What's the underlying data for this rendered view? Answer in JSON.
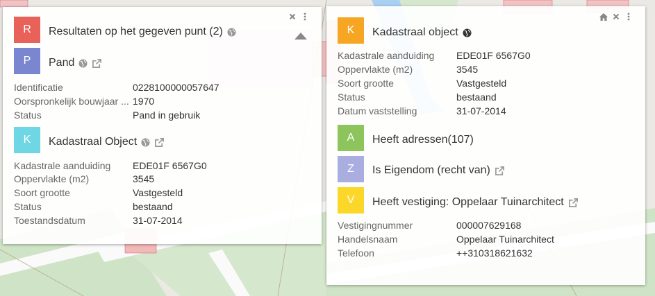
{
  "colors": {
    "red": "#e8625a",
    "purple": "#7b86d1",
    "cyan": "#6fd6e4",
    "orange": "#f7a624",
    "green": "#8dc45c",
    "lavender": "#a9addf",
    "yellow": "#fbd72a"
  },
  "left_panel": {
    "result": {
      "letter": "R",
      "title": "Resultaten op het gegeven punt (2)"
    },
    "pand": {
      "letter": "P",
      "title": "Pand",
      "rows": [
        {
          "label": "Identificatie",
          "value": "0228100000057647"
        },
        {
          "label": "Oorspronkelijk bouwjaar ...",
          "value": "1970"
        },
        {
          "label": "Status",
          "value": "Pand in gebruik"
        }
      ]
    },
    "kadastraal": {
      "letter": "K",
      "title": "Kadastraal Object",
      "rows": [
        {
          "label": "Kadastrale aanduiding",
          "value": "EDE01F 6567G0"
        },
        {
          "label": "Oppervlakte (m2)",
          "value": "3545"
        },
        {
          "label": "Soort grootte",
          "value": "Vastgesteld"
        },
        {
          "label": "Status",
          "value": "bestaand"
        },
        {
          "label": "Toestandsdatum",
          "value": "31-07-2014"
        }
      ]
    }
  },
  "right_panel": {
    "kadastraal": {
      "letter": "K",
      "title": "Kadastraal object",
      "rows": [
        {
          "label": "Kadastrale aanduiding",
          "value": "EDE01F 6567G0"
        },
        {
          "label": "Oppervlakte (m2)",
          "value": "3545"
        },
        {
          "label": "Soort grootte",
          "value": "Vastgesteld"
        },
        {
          "label": "Status",
          "value": "bestaand"
        },
        {
          "label": "Datum vaststelling",
          "value": "31-07-2014"
        }
      ]
    },
    "adressen": {
      "letter": "A",
      "title": "Heeft adressen(107)"
    },
    "eigendom": {
      "letter": "Z",
      "title": "Is Eigendom (recht van)"
    },
    "vestiging": {
      "letter": "V",
      "title": "Heeft vestiging: Oppelaar Tuinarchitect",
      "rows": [
        {
          "label": "Vestigingnummer",
          "value": "000007629168"
        },
        {
          "label": "Handelsnaam",
          "value": "Oppelaar Tuinarchitect"
        },
        {
          "label": "Telefoon",
          "value": "++310318621632"
        }
      ]
    }
  },
  "icons": {
    "globe": "globe-icon",
    "external": "external-link-icon",
    "close": "close-icon",
    "menu": "kebab-menu-icon",
    "home": "home-icon",
    "collapse": "collapse-triangle-icon"
  }
}
